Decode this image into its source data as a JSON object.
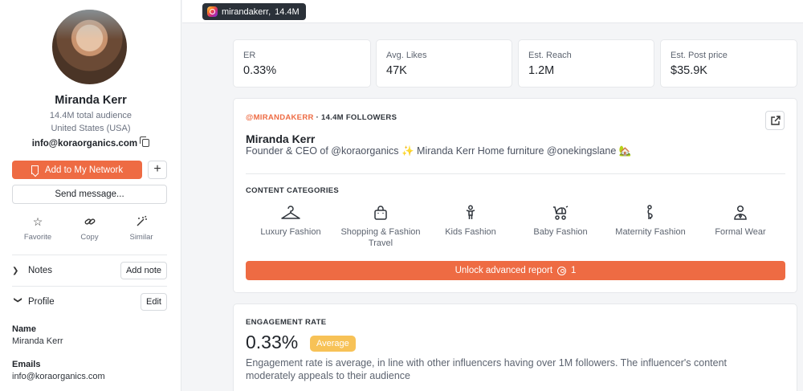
{
  "sidebar": {
    "name": "Miranda Kerr",
    "total_audience": "14.4M total audience",
    "location": "United States (USA)",
    "email": "info@koraorganics.com",
    "add_network_label": "Add to My Network",
    "plus_label": "+",
    "send_message_label": "Send message...",
    "actions": [
      {
        "label": "Favorite",
        "icon": "star-icon"
      },
      {
        "label": "Copy",
        "icon": "link-icon"
      },
      {
        "label": "Similar",
        "icon": "magic-wand-icon"
      }
    ],
    "notes": {
      "title": "Notes",
      "button": "Add note"
    },
    "profile": {
      "title": "Profile",
      "button": "Edit"
    },
    "fields": [
      {
        "label": "Name",
        "value": "Miranda Kerr"
      },
      {
        "label": "Emails",
        "value": "info@koraorganics.com"
      }
    ]
  },
  "topbar": {
    "handle": "mirandakerr,",
    "followers": "14.4M",
    "platform_icon": "instagram-icon"
  },
  "stats": [
    {
      "label": "ER",
      "value": "0.33%"
    },
    {
      "label": "Avg. Likes",
      "value": "47K"
    },
    {
      "label": "Est. Reach",
      "value": "1.2M"
    },
    {
      "label": "Est. Post price",
      "value": "$35.9K"
    }
  ],
  "profile_card": {
    "handle": "@MIRANDAKERR",
    "followers": " · 14.4M FOLLOWERS",
    "name": "Miranda Kerr",
    "bio": "Founder & CEO of @koraorganics ✨ Miranda Kerr Home furniture @onekingslane 🏡",
    "categories_title": "CONTENT CATEGORIES",
    "categories": [
      {
        "label": "Luxury Fashion",
        "icon": "hanger-icon"
      },
      {
        "label": "Shopping & Fashion Travel",
        "icon": "shopping-bag-icon"
      },
      {
        "label": "Kids Fashion",
        "icon": "child-icon"
      },
      {
        "label": "Baby Fashion",
        "icon": "stroller-icon"
      },
      {
        "label": "Maternity Fashion",
        "icon": "pregnant-icon"
      },
      {
        "label": "Formal Wear",
        "icon": "person-tie-icon"
      }
    ],
    "unlock_label": "Unlock advanced report",
    "unlock_cost": "1"
  },
  "engagement": {
    "title": "ENGAGEMENT RATE",
    "value": "0.33%",
    "badge": "Average",
    "description": "Engagement rate is average, in line with other influencers having over 1M followers. The influencer's content moderately appeals to their audience"
  },
  "colors": {
    "accent": "#ee6b43",
    "badge": "#f7c257",
    "pill_bg": "#2b3139"
  }
}
